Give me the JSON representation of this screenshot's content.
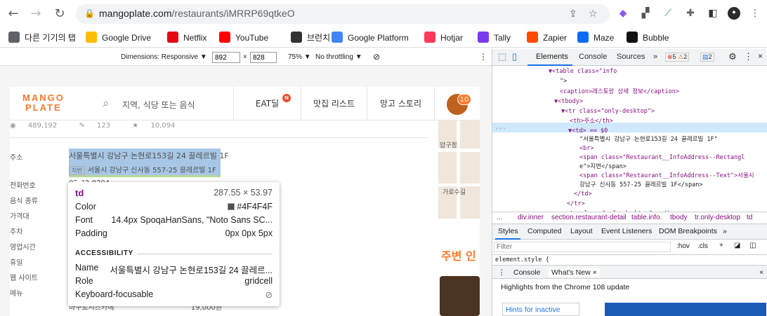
{
  "browser": {
    "url_host": "mangoplate.com",
    "url_path": "/restaurants/iMRRP69qtkeO"
  },
  "bookmarks": [
    {
      "label": "다른 기기의 탭",
      "icon": "history-icon",
      "color": "#5f6368"
    },
    {
      "label": "Google Drive",
      "icon": "google-drive-icon",
      "color": "#fbbc04"
    },
    {
      "label": "Netflix",
      "icon": "netflix-icon",
      "color": "#e50914"
    },
    {
      "label": "YouTube",
      "icon": "youtube-icon",
      "color": "#ff0000"
    },
    {
      "label": "브런치",
      "icon": "brunch-icon",
      "color": "#333333"
    },
    {
      "label": "Google Platform",
      "icon": "google-icon",
      "color": "#4285f4"
    },
    {
      "label": "Hotjar",
      "icon": "hotjar-icon",
      "color": "#fd3a5c"
    },
    {
      "label": "Tally",
      "icon": "tally-icon",
      "color": "#7c3aed"
    },
    {
      "label": "Zapier",
      "icon": "zapier-icon",
      "color": "#ff4a00"
    },
    {
      "label": "Maze",
      "icon": "maze-icon",
      "color": "#0a6cf5"
    },
    {
      "label": "Bubble",
      "icon": "bubble-icon",
      "color": "#111111"
    }
  ],
  "device_toolbar": {
    "dimensions": "Dimensions: Responsive ▼",
    "width": "892",
    "times": "×",
    "height": "828",
    "zoom": "75% ▼",
    "throttle": "No throttling ▼"
  },
  "site": {
    "logo_line1": "MANGO",
    "logo_line2": "PLATE",
    "search_placeholder": "지역, 식당 또는 음식",
    "nav": [
      "EAT딜",
      "맛집 리스트",
      "망고 스토리"
    ],
    "eat_badge": "N",
    "avatar_badge": "10",
    "stats": {
      "views": "489,192",
      "reviews": "123",
      "favorites": "10,094"
    },
    "labels": [
      "주소",
      "전화번호",
      "음식 종류",
      "가격대",
      "주차",
      "영업시간",
      "휴일",
      "웹 사이트",
      "메뉴"
    ],
    "address_main": "서울특별시 강남구 논현로153길 24 끌레르빌 1F",
    "address_tag": "지번",
    "address_old": "서울시 강남구 신사동 557-25 끌레르빌 1F",
    "phone_partial": "02-42-8204",
    "menu_item": "마구로시츠카에",
    "menu_price": "19,000원",
    "near_title": "주변 인",
    "map_labels": [
      "압구정",
      "가로수길"
    ],
    "brand_color": "#ff792a"
  },
  "tooltip": {
    "tag": "td",
    "size": "287.55 × 53.97",
    "color_label": "Color",
    "color_value": "#4F4F4F",
    "font_label": "Font",
    "font_value": "14.4px SpoqaHanSans, \"Noto Sans SC...",
    "padding_label": "Padding",
    "padding_value": "0px 0px 5px",
    "accessibility_heading": "ACCESSIBILITY",
    "name_label": "Name",
    "name_value": "서울특별시 강남구 논현로153길 24 끌레르...",
    "role_label": "Role",
    "role_value": "gridcell",
    "focus_label": "Keyboard-focusable"
  },
  "devtools": {
    "tabs": [
      "Elements",
      "Console",
      "Sources",
      "»"
    ],
    "errors": "5",
    "warnings": "2",
    "messages": "2",
    "dom": [
      {
        "t": "▼<table class=\"info"
      },
      {
        "t": "\">"
      },
      {
        "t": "<caption>레스토랑 상세 정보</caption>"
      },
      {
        "t": "▼<tbody>"
      },
      {
        "t": "▼<tr class=\"only-desktop\">"
      },
      {
        "t": "<th>주소</th>"
      },
      {
        "t": "▼<td> == $0"
      },
      {
        "t": "\"서울특별시 강남구 논현로153길 24 끌레르빌 1F\""
      },
      {
        "t": "<br>"
      },
      {
        "t": "<span class=\"Restaurant__InfoAddress--Rectangl"
      },
      {
        "t": "e\">지번</span>"
      },
      {
        "t": "<span class=\"Restaurant__InfoAddress--Text\">서울시"
      },
      {
        "t": "강남구 신사동 557-25 끌레르빌 1F</span>"
      },
      {
        "t": "</td>"
      },
      {
        "t": "</tr>"
      },
      {
        "t": "▶<tr class=\"only-desktop\">…</tr>"
      }
    ],
    "crumbs": [
      "...",
      "div.inner",
      "section.restaurant-detail",
      "table.info.",
      "tbody",
      "tr.only-desktop",
      "td"
    ],
    "style_tabs": [
      "Styles",
      "Computed",
      "Layout",
      "Event Listeners",
      "DOM Breakpoints",
      "»"
    ],
    "filter_placeholder": "Filter",
    "hov": ":hov",
    "cls": ".cls",
    "element_style": "element.style {",
    "drawer_tabs": [
      "Console",
      "What's New ×"
    ],
    "highlights": "Highlights from the Chrome 108 update",
    "hints": "Hints for inactive"
  }
}
